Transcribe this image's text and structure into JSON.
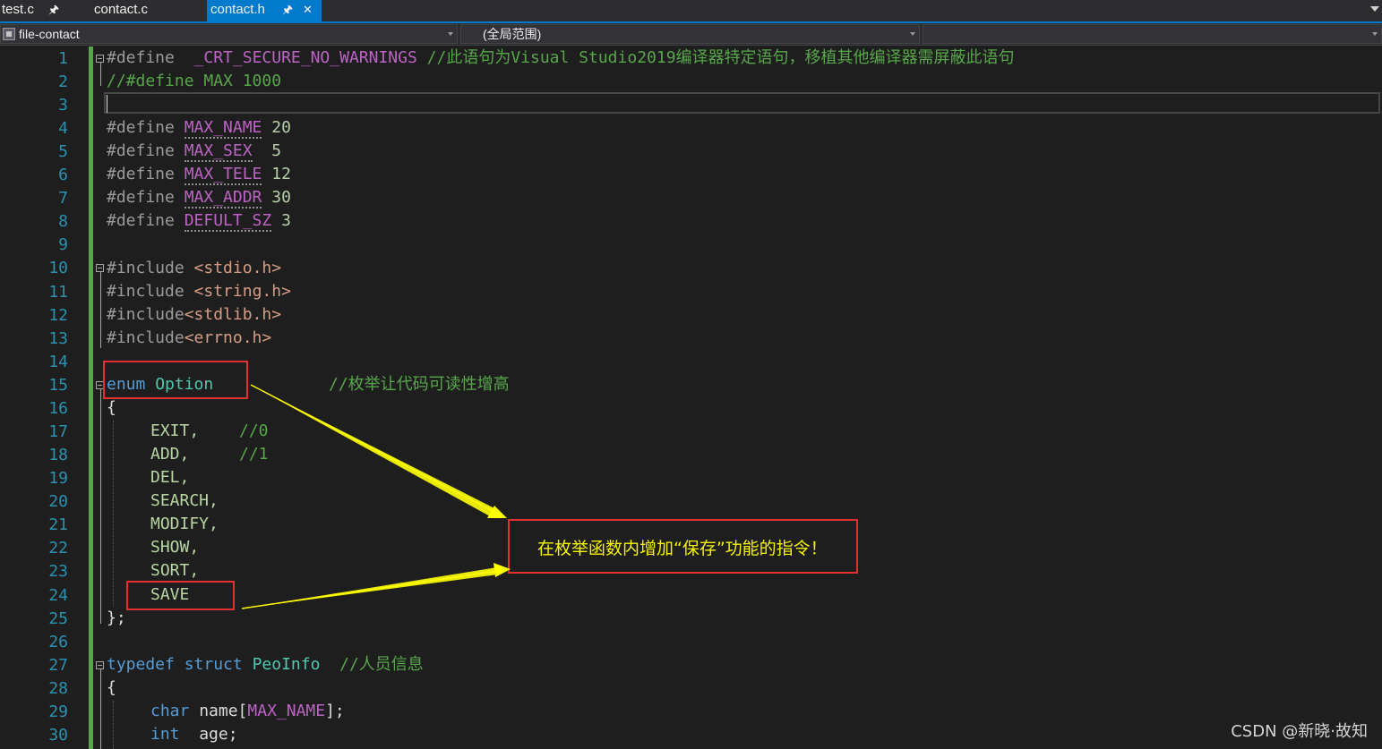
{
  "tabs": [
    {
      "label": "test.c",
      "pin": "🖈"
    },
    {
      "label": "contact.c"
    },
    {
      "label": "contact.h",
      "pin": "🖈",
      "close": "✕",
      "active": true
    }
  ],
  "nav": {
    "project": "file-contact",
    "scope": "(全局范围)"
  },
  "line_numbers": [
    "1",
    "2",
    "3",
    "4",
    "5",
    "6",
    "7",
    "8",
    "9",
    "10",
    "11",
    "12",
    "13",
    "14",
    "15",
    "16",
    "17",
    "18",
    "19",
    "20",
    "21",
    "22",
    "23",
    "24",
    "25",
    "26",
    "27",
    "28",
    "29",
    "30"
  ],
  "code": {
    "l1": {
      "pp": "#define",
      "sp": "  ",
      "macro": "_CRT_SECURE_NO_WARNINGS",
      "gap": " ",
      "comment": "//此语句为Visual Studio2019编译器特定语句，移植其他编译器需屏蔽此语句"
    },
    "l2": {
      "comment": "//#define MAX 1000"
    },
    "l4": {
      "pp": "#define",
      "macro": "MAX_NAME",
      "value": "20"
    },
    "l5": {
      "pp": "#define",
      "macro": "MAX_SEX",
      "value": "5"
    },
    "l6": {
      "pp": "#define",
      "macro": "MAX_TELE",
      "value": "12"
    },
    "l7": {
      "pp": "#define",
      "macro": "MAX_ADDR",
      "value": "30"
    },
    "l8": {
      "pp": "#define",
      "macro": "DEFULT_SZ",
      "value": "3"
    },
    "l10": {
      "pp": "#include",
      "header": "<stdio.h>"
    },
    "l11": {
      "pp": "#include",
      "header": "<string.h>"
    },
    "l12": {
      "pp": "#include",
      "header": "<stdlib.h>"
    },
    "l13": {
      "pp": "#include",
      "header": "<errno.h>"
    },
    "l15": {
      "kw": "enum",
      "name": "Option",
      "comment": "//枚举让代码可读性增高"
    },
    "l16": {
      "text": "{"
    },
    "l17": {
      "member": "EXIT,",
      "comment": "//0"
    },
    "l18": {
      "member": "ADD,",
      "comment": "//1"
    },
    "l19": {
      "member": "DEL,"
    },
    "l20": {
      "member": "SEARCH,"
    },
    "l21": {
      "member": "MODIFY,"
    },
    "l22": {
      "member": "SHOW,"
    },
    "l23": {
      "member": "SORT,"
    },
    "l24": {
      "member": "SAVE"
    },
    "l25": {
      "text": "};"
    },
    "l27": {
      "kw1": "typedef",
      "kw2": "struct",
      "name": "PeoInfo",
      "comment": "//人员信息"
    },
    "l28": {
      "text": "{"
    },
    "l29": {
      "kw": "char",
      "field": "name[",
      "macro": "MAX_NAME",
      "tail": "];"
    },
    "l30": {
      "kw": "int",
      "field": "age;"
    }
  },
  "annotation": {
    "callout_text": "在枚举函数内增加“保存”功能的指令！",
    "arrow_color": "#ffff00",
    "box_color": "#e03030"
  },
  "watermark": "CSDN @新晓·故知"
}
